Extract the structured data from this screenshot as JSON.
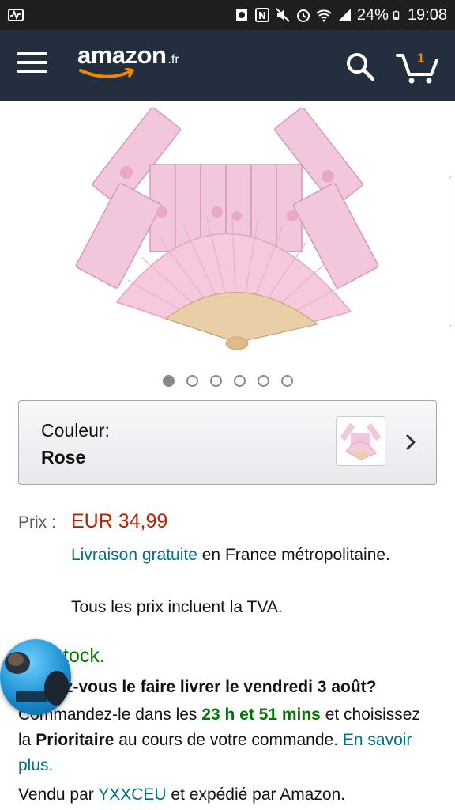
{
  "status_bar": {
    "battery": "24%",
    "time": "19:08"
  },
  "header": {
    "logo": "amazon",
    "logo_tld": ".fr",
    "cart_count": "1",
    "brand_dark": "#232f3e",
    "accent": "#f08804"
  },
  "gallery": {
    "image_count": 6,
    "active_index": 0
  },
  "color_selector": {
    "label": "Couleur:",
    "value": "Rose"
  },
  "price": {
    "label": "Prix :",
    "value": "EUR 34,99"
  },
  "shipping": {
    "link_text": "Livraison gratuite",
    "rest": " en France métropolitaine."
  },
  "tva_note": "Tous les prix incluent la TVA.",
  "stock": "tock.",
  "delivery_question": "z-vous le faire livrer le vendredi 3 août?",
  "order": {
    "part1": "Commandez-le dans les ",
    "countdown": "23 h et 51 mins",
    "part2": " et choisissez la ",
    "option": "Prioritaire",
    "part3": " au cours de votre commande. ",
    "link": "En savoir plus."
  },
  "sold_by": {
    "prefix": "Vendu par ",
    "seller": "YXXCEU",
    "suffix": " et expédié par Amazon."
  },
  "icons": [
    "menu-icon",
    "search-icon",
    "cart-icon",
    "chevron-right-icon",
    "wifi-icon",
    "signal-icon",
    "battery-icon"
  ]
}
